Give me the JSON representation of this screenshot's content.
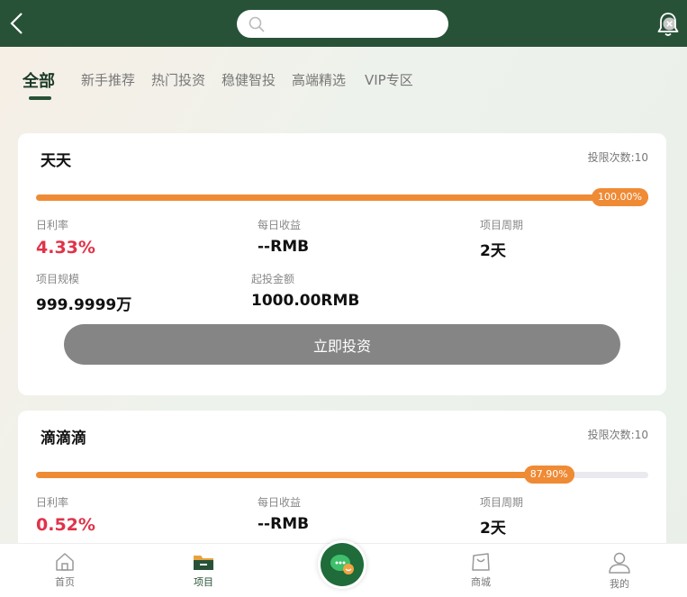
{
  "search": {
    "placeholder": "",
    "value": ""
  },
  "tabs": [
    {
      "label": "全部",
      "active": true
    },
    {
      "label": "新手推荐"
    },
    {
      "label": "热门投资"
    },
    {
      "label": "稳健智投"
    },
    {
      "label": "高端精选"
    },
    {
      "label": "VIP专区"
    }
  ],
  "projects": [
    {
      "name": "天天",
      "limit": "投限次数:10",
      "progress": 1.0,
      "progress_label": "100.00%",
      "rate_label": "日利率",
      "rate": "4.33%",
      "income_label": "每日收益",
      "income": "--RMB",
      "period_label": "项目周期",
      "period": "2天",
      "scale_label": "项目规模",
      "scale": "999.9999万",
      "min_label": "起投金额",
      "min": "1000.00RMB",
      "button_label": "立即投资"
    },
    {
      "name": "滴滴滴",
      "limit": "投限次数:10",
      "progress": 0.879,
      "progress_label": "87.90%",
      "rate_label": "日利率",
      "rate": "0.52%",
      "income_label": "每日收益",
      "income": "--RMB",
      "period_label": "项目周期",
      "period": "2天"
    }
  ],
  "bottom_nav": [
    {
      "label": "首页",
      "icon": "home-icon"
    },
    {
      "label": "项目",
      "icon": "folder-icon",
      "active": true
    },
    {
      "label": "",
      "icon": "chat-icon"
    },
    {
      "label": "商城",
      "icon": "shop-bag-icon"
    },
    {
      "label": "我的",
      "icon": "user-icon"
    }
  ],
  "colors": {
    "header": "#285238",
    "progress": "#ef8a35",
    "rate": "#e0334a",
    "button": "#858585"
  }
}
